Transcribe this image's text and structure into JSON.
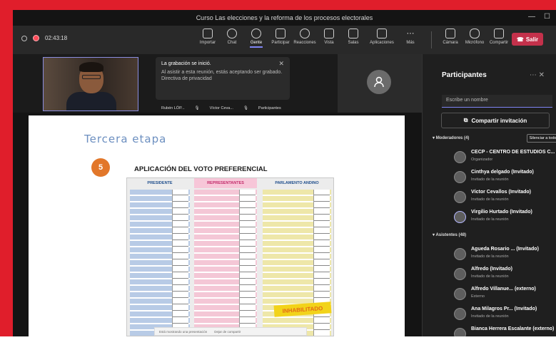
{
  "window": {
    "title": "Curso Las elecciones y la reforma de los procesos electorales"
  },
  "toolbar": {
    "timer": "02:43:18",
    "items": [
      {
        "label": "Importar",
        "icon": "gallery-icon"
      },
      {
        "label": "Chat",
        "icon": "chat-icon"
      },
      {
        "label": "Gente",
        "icon": "people-icon"
      },
      {
        "label": "Participar",
        "icon": "raise-hand-icon"
      },
      {
        "label": "Reacciones",
        "icon": "reactions-icon"
      },
      {
        "label": "Vista",
        "icon": "view-icon"
      },
      {
        "label": "Salas",
        "icon": "rooms-icon"
      },
      {
        "label": "Aplicaciones",
        "icon": "apps-icon"
      },
      {
        "label": "Más",
        "icon": "more-icon"
      }
    ],
    "devices": [
      {
        "label": "Cámara",
        "icon": "camera-off-icon"
      },
      {
        "label": "Micrófono",
        "icon": "mic-off-icon"
      },
      {
        "label": "Compartir",
        "icon": "share-screen-icon"
      }
    ],
    "leave_label": "Salir"
  },
  "notification": {
    "title": "La grabación se inició.",
    "body": "Al asistir a esta reunión, estás aceptando ser grabado. Directiva de privacidad",
    "names": [
      "Rubén LÓP...",
      "Víctor Ceva...",
      "Participantes"
    ]
  },
  "slide": {
    "stage_title": "Tercera etapa",
    "step_number": "5",
    "heading": "APLICACIÓN DEL VOTO PREFERENCIAL",
    "ballot_headers": [
      "PRESIDENTE",
      "REPRESENTANTES",
      "PARLAMENTO ANDINO"
    ],
    "stamp_text": "INHABILITADO",
    "share_info": [
      "Está mostrando una presentación",
      "Dejar de compartir"
    ]
  },
  "panel": {
    "title": "Participantes",
    "search_placeholder": "Escribe un nombre",
    "share_invite": "Compartir invitación",
    "moderators_label": "Moderadores (4)",
    "mute_all": "Silenciar a todos",
    "attendees_label": "Asistentes (48)",
    "moderators": [
      {
        "name": "CECP - CENTRO DE ESTUDIOS C...",
        "role": "Organizador"
      },
      {
        "name": "Cinthya delgado (Invitado)",
        "role": "Invitado de la reunión"
      },
      {
        "name": "Víctor Cevallos (Invitado)",
        "role": "Invitado de la reunión"
      },
      {
        "name": "Virgilio Hurtado (Invitado)",
        "role": "Invitado de la reunión"
      }
    ],
    "attendees": [
      {
        "name": "Agueda Rosario ... (Invitado)",
        "role": "Invitado de la reunión"
      },
      {
        "name": "Alfredo (Invitado)",
        "role": "Invitado de la reunión"
      },
      {
        "name": "Alfredo Villanue... (externo)",
        "role": "Externo"
      },
      {
        "name": "Ana Milagros Pr... (Invitado)",
        "role": "Invitado de la reunión"
      },
      {
        "name": "Bianca Herrera Escalante (externo)",
        "role": ""
      }
    ]
  }
}
